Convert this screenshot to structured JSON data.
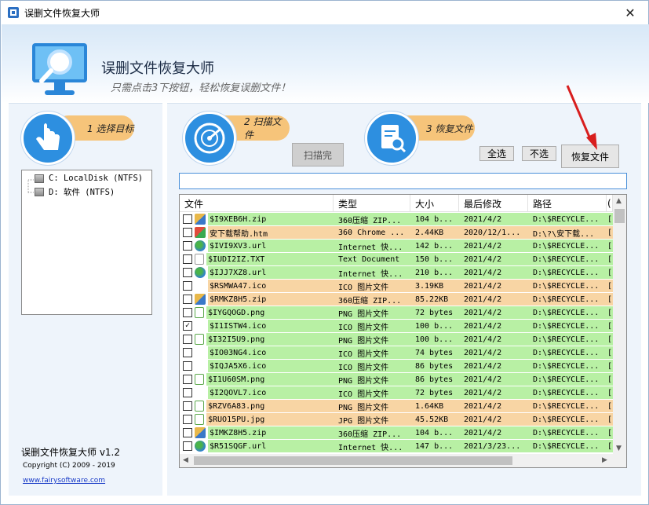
{
  "window": {
    "title": "误删文件恢复大师",
    "close_label": "✕"
  },
  "banner": {
    "title": "误删文件恢复大师",
    "subtitle": "只需点击3下按钮，轻松恢复误删文件！"
  },
  "steps": [
    {
      "label": "1 选择目标",
      "icon": "hand-pointer-icon"
    },
    {
      "label": "2 扫描文件",
      "icon": "radar-icon"
    },
    {
      "label": "3 恢复文件",
      "icon": "document-search-icon"
    }
  ],
  "drives": [
    {
      "label": "C: LocalDisk (NTFS)"
    },
    {
      "label": "D: 软件 (NTFS)"
    }
  ],
  "buttons": {
    "scan_done": "扫描完",
    "select_all": "全选",
    "select_none": "不选",
    "recover": "恢复文件"
  },
  "path_value": "",
  "columns": [
    "文件",
    "类型",
    "大小",
    "最后修改",
    "路径",
    "("
  ],
  "files": [
    {
      "name": "$I9XEB6H.zip",
      "type": "360压缩 ZIP...",
      "size": "104 b...",
      "modified": "2021/4/2",
      "path": "D:\\$RECYCLE...",
      "extra": "[",
      "color": "green",
      "checked": false,
      "icon": "zip-icon"
    },
    {
      "name": "安下载帮助.htm",
      "type": "360 Chrome ...",
      "size": "2.44KB",
      "modified": "2020/12/1...",
      "path": "D:\\?\\安下载...",
      "extra": "[",
      "color": "orange",
      "checked": false,
      "icon": "browser-icon"
    },
    {
      "name": "$IVI9XV3.url",
      "type": "Internet 快...",
      "size": "142 b...",
      "modified": "2021/4/2",
      "path": "D:\\$RECYCLE...",
      "extra": "[",
      "color": "green",
      "checked": false,
      "icon": "globe-icon"
    },
    {
      "name": "$IUDI2IZ.TXT",
      "type": "Text Document",
      "size": "150 b...",
      "modified": "2021/4/2",
      "path": "D:\\$RECYCLE...",
      "extra": "[",
      "color": "green",
      "checked": false,
      "icon": "text-file-icon"
    },
    {
      "name": "$IJJ7XZ8.url",
      "type": "Internet 快...",
      "size": "210 b...",
      "modified": "2021/4/2",
      "path": "D:\\$RECYCLE...",
      "extra": "[",
      "color": "green",
      "checked": false,
      "icon": "globe-icon"
    },
    {
      "name": "$RSMWA47.ico",
      "type": "ICO 图片文件",
      "size": "3.19KB",
      "modified": "2021/4/2",
      "path": "D:\\$RECYCLE...",
      "extra": "[",
      "color": "orange",
      "checked": false,
      "icon": ""
    },
    {
      "name": "$RMKZ8H5.zip",
      "type": "360压缩 ZIP...",
      "size": "85.22KB",
      "modified": "2021/4/2",
      "path": "D:\\$RECYCLE...",
      "extra": "[",
      "color": "orange",
      "checked": false,
      "icon": "zip-icon"
    },
    {
      "name": "$IYGQOGD.png",
      "type": "PNG 图片文件",
      "size": "72 bytes",
      "modified": "2021/4/2",
      "path": "D:\\$RECYCLE...",
      "extra": "[",
      "color": "green",
      "checked": false,
      "icon": "image-file-icon"
    },
    {
      "name": "$I1ISTW4.ico",
      "type": "ICO 图片文件",
      "size": "100 b...",
      "modified": "2021/4/2",
      "path": "D:\\$RECYCLE...",
      "extra": "[",
      "color": "green",
      "checked": true,
      "icon": ""
    },
    {
      "name": "$I32I5U9.png",
      "type": "PNG 图片文件",
      "size": "100 b...",
      "modified": "2021/4/2",
      "path": "D:\\$RECYCLE...",
      "extra": "[",
      "color": "green",
      "checked": false,
      "icon": "image-file-icon"
    },
    {
      "name": "$IO03NG4.ico",
      "type": "ICO 图片文件",
      "size": "74 bytes",
      "modified": "2021/4/2",
      "path": "D:\\$RECYCLE...",
      "extra": "[",
      "color": "green",
      "checked": false,
      "icon": ""
    },
    {
      "name": "$IQJA5X6.ico",
      "type": "ICO 图片文件",
      "size": "86 bytes",
      "modified": "2021/4/2",
      "path": "D:\\$RECYCLE...",
      "extra": "[",
      "color": "green",
      "checked": false,
      "icon": ""
    },
    {
      "name": "$I1U60SM.png",
      "type": "PNG 图片文件",
      "size": "86 bytes",
      "modified": "2021/4/2",
      "path": "D:\\$RECYCLE...",
      "extra": "[",
      "color": "green",
      "checked": false,
      "icon": "image-file-icon"
    },
    {
      "name": "$I2QOVL7.ico",
      "type": "ICO 图片文件",
      "size": "72 bytes",
      "modified": "2021/4/2",
      "path": "D:\\$RECYCLE...",
      "extra": "[",
      "color": "green",
      "checked": false,
      "icon": ""
    },
    {
      "name": "$RZV6A83.png",
      "type": "PNG 图片文件",
      "size": "1.64KB",
      "modified": "2021/4/2",
      "path": "D:\\$RECYCLE...",
      "extra": "[",
      "color": "orange",
      "checked": false,
      "icon": "image-file-icon"
    },
    {
      "name": "$RUO15PU.jpg",
      "type": "JPG 图片文件",
      "size": "45.52KB",
      "modified": "2021/4/2",
      "path": "D:\\$RECYCLE...",
      "extra": "[",
      "color": "orange",
      "checked": false,
      "icon": "image-file-icon"
    },
    {
      "name": "$IMKZ8H5.zip",
      "type": "360压缩 ZIP...",
      "size": "104 b...",
      "modified": "2021/4/2",
      "path": "D:\\$RECYCLE...",
      "extra": "[",
      "color": "green",
      "checked": false,
      "icon": "zip-icon"
    },
    {
      "name": "$R51SQGF.url",
      "type": "Internet 快...",
      "size": "147 b...",
      "modified": "2021/3/23...",
      "path": "D:\\$RECYCLE...",
      "extra": "[",
      "color": "green",
      "checked": false,
      "icon": "globe-icon"
    }
  ],
  "footer": {
    "name": "误删文件恢复大师 v1.2",
    "copyright": "Copyright (C) 2009 - 2019",
    "link": "www.fairysoftware.com"
  },
  "colors": {
    "found": "#b8f0a4",
    "deleted": "#f8d5a4",
    "accent": "#2d8fe0",
    "pill": "#f6c47a"
  }
}
